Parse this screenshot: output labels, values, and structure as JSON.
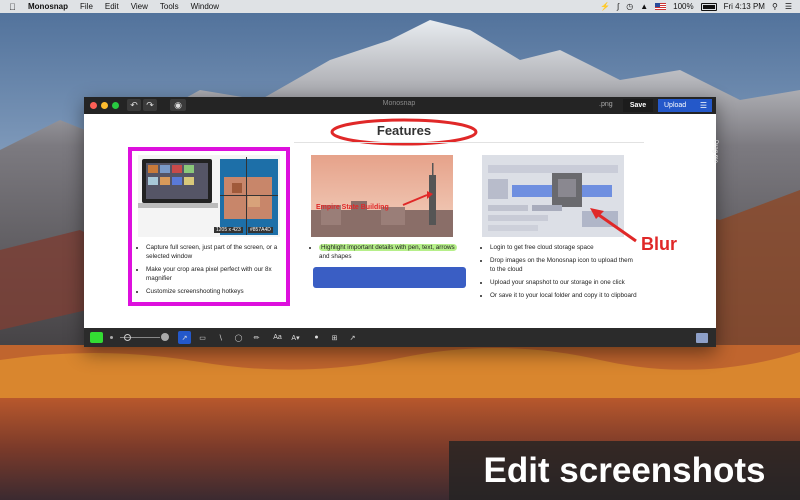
{
  "menubar": {
    "app": "Monosnap",
    "items": [
      "File",
      "Edit",
      "View",
      "Tools",
      "Window"
    ],
    "battery": "100%",
    "clock": "Fri 4:13 PM"
  },
  "window": {
    "title": "Monosnap",
    "format": ".png",
    "save_label": "Save",
    "upload_label": "Upload"
  },
  "content": {
    "heading": "Features",
    "col1": {
      "size_badge": "1205 x 423",
      "color_badge": "#857A4D",
      "bullets": [
        "Capture full screen, just part of the screen, or a selected window",
        "Make your crop area pixel perfect with our 8x magnifier",
        "Customize screenshooting hotkeys"
      ]
    },
    "col2": {
      "image_label": "Empire State Building",
      "bullets": [
        "Highlight important details with pen, text, arrows",
        "and shapes"
      ]
    },
    "col3": {
      "bullets": [
        "Login to get free cloud storage space",
        "Drop images on the Monosnap icon to upload them to the cloud",
        "Upload your snapshot to our storage in one click",
        "Or save it to your local folder and copy it to clipboard"
      ]
    }
  },
  "annotations": {
    "blur_label": "Blur",
    "drag_label": "Drag me"
  },
  "toolbar": {
    "text_tool": "Aa",
    "active_color": "#33dd33"
  },
  "caption": "Edit screenshots",
  "colors": {
    "accent_blue": "#2458c9",
    "annotation_red": "#e02828",
    "frame_magenta": "#dd10dd",
    "highlight_green": "#b6ef8a"
  }
}
